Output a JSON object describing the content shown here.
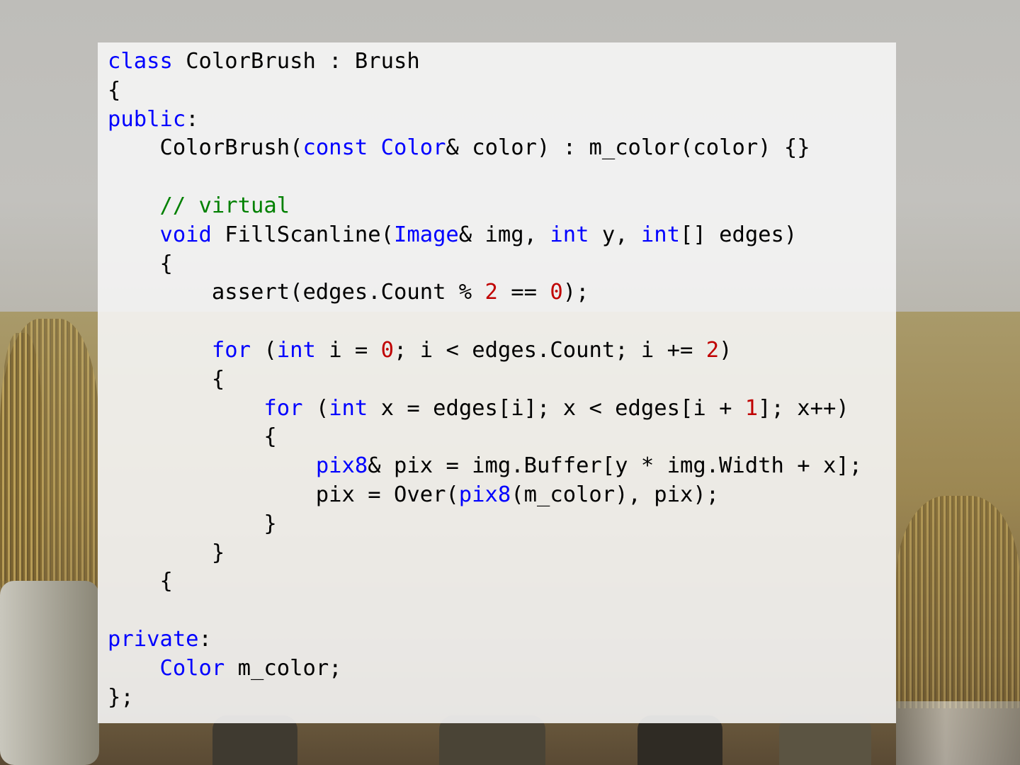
{
  "colors": {
    "keyword": "#0000ff",
    "type": "#0000ff",
    "comment": "#008000",
    "number": "#c00000",
    "plain": "#000000"
  },
  "code_lines": [
    [
      {
        "t": "keyword",
        "s": "class"
      },
      {
        "t": "plain",
        "s": " ColorBrush : Brush"
      }
    ],
    [
      {
        "t": "plain",
        "s": "{"
      }
    ],
    [
      {
        "t": "keyword",
        "s": "public"
      },
      {
        "t": "plain",
        "s": ":"
      }
    ],
    [
      {
        "t": "plain",
        "s": "    ColorBrush("
      },
      {
        "t": "keyword",
        "s": "const"
      },
      {
        "t": "plain",
        "s": " "
      },
      {
        "t": "type",
        "s": "Color"
      },
      {
        "t": "plain",
        "s": "& color) : m_color(color) {}"
      }
    ],
    [
      {
        "t": "plain",
        "s": ""
      }
    ],
    [
      {
        "t": "comment",
        "s": "    // virtual"
      }
    ],
    [
      {
        "t": "plain",
        "s": "    "
      },
      {
        "t": "keyword",
        "s": "void"
      },
      {
        "t": "plain",
        "s": " FillScanline("
      },
      {
        "t": "type",
        "s": "Image"
      },
      {
        "t": "plain",
        "s": "& img, "
      },
      {
        "t": "keyword",
        "s": "int"
      },
      {
        "t": "plain",
        "s": " y, "
      },
      {
        "t": "keyword",
        "s": "int"
      },
      {
        "t": "plain",
        "s": "[] edges)"
      }
    ],
    [
      {
        "t": "plain",
        "s": "    {"
      }
    ],
    [
      {
        "t": "plain",
        "s": "        assert(edges.Count % "
      },
      {
        "t": "number",
        "s": "2"
      },
      {
        "t": "plain",
        "s": " == "
      },
      {
        "t": "number",
        "s": "0"
      },
      {
        "t": "plain",
        "s": ");"
      }
    ],
    [
      {
        "t": "plain",
        "s": ""
      }
    ],
    [
      {
        "t": "plain",
        "s": "        "
      },
      {
        "t": "keyword",
        "s": "for"
      },
      {
        "t": "plain",
        "s": " ("
      },
      {
        "t": "keyword",
        "s": "int"
      },
      {
        "t": "plain",
        "s": " i = "
      },
      {
        "t": "number",
        "s": "0"
      },
      {
        "t": "plain",
        "s": "; i < edges.Count; i += "
      },
      {
        "t": "number",
        "s": "2"
      },
      {
        "t": "plain",
        "s": ")"
      }
    ],
    [
      {
        "t": "plain",
        "s": "        {"
      }
    ],
    [
      {
        "t": "plain",
        "s": "            "
      },
      {
        "t": "keyword",
        "s": "for"
      },
      {
        "t": "plain",
        "s": " ("
      },
      {
        "t": "keyword",
        "s": "int"
      },
      {
        "t": "plain",
        "s": " x = edges[i]; x < edges[i + "
      },
      {
        "t": "number",
        "s": "1"
      },
      {
        "t": "plain",
        "s": "]; x++)"
      }
    ],
    [
      {
        "t": "plain",
        "s": "            {"
      }
    ],
    [
      {
        "t": "plain",
        "s": "                "
      },
      {
        "t": "type",
        "s": "pix8"
      },
      {
        "t": "plain",
        "s": "& pix = img.Buffer[y * img.Width + x];"
      }
    ],
    [
      {
        "t": "plain",
        "s": "                pix = Over("
      },
      {
        "t": "type",
        "s": "pix8"
      },
      {
        "t": "plain",
        "s": "(m_color), pix);"
      }
    ],
    [
      {
        "t": "plain",
        "s": "            }"
      }
    ],
    [
      {
        "t": "plain",
        "s": "        }"
      }
    ],
    [
      {
        "t": "plain",
        "s": "    {"
      }
    ],
    [
      {
        "t": "plain",
        "s": ""
      }
    ],
    [
      {
        "t": "keyword",
        "s": "private"
      },
      {
        "t": "plain",
        "s": ":"
      }
    ],
    [
      {
        "t": "plain",
        "s": "    "
      },
      {
        "t": "type",
        "s": "Color"
      },
      {
        "t": "plain",
        "s": " m_color;"
      }
    ],
    [
      {
        "t": "plain",
        "s": "};"
      }
    ]
  ]
}
